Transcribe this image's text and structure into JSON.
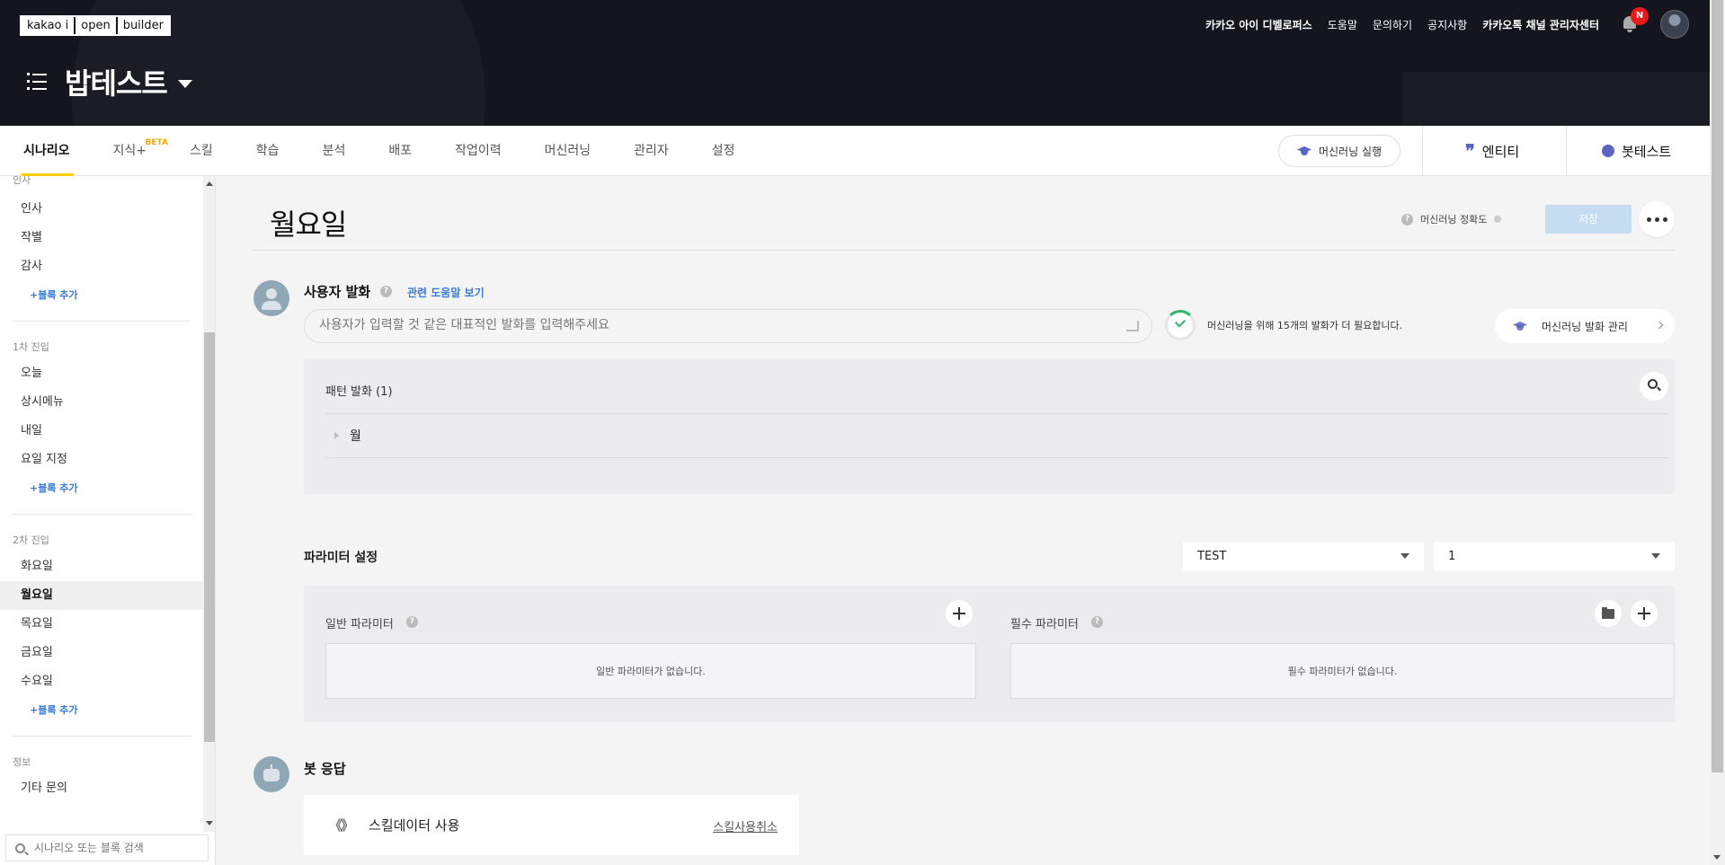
{
  "header": {
    "logo_parts": [
      "kakao i",
      "open",
      "builder"
    ],
    "bot_name": "밥테스트",
    "links": [
      "카카오 아이 디벨로퍼스",
      "도움말",
      "문의하기",
      "공지사항",
      "카카오톡 채널 관리자센터"
    ],
    "notification_badge": "N"
  },
  "nav": {
    "tabs": [
      "시나리오",
      "지식+",
      "스킬",
      "학습",
      "분석",
      "배포",
      "작업이력",
      "머신러닝",
      "관리자",
      "설정"
    ],
    "beta_label": "BETA",
    "ml_run_label": "머신러닝 실행",
    "entity_label": "엔티티",
    "bottest_label": "봇테스트"
  },
  "sidebar": {
    "top_group_label": "인사",
    "top_items": [
      "인사",
      "작별",
      "감사"
    ],
    "add_block_label": "+블록 추가",
    "group1_label": "1차 진입",
    "group1_items": [
      "오늘",
      "상시메뉴",
      "내일",
      "요일 지정"
    ],
    "group2_label": "2차 진입",
    "group2_items": [
      "화요일",
      "월요일",
      "목요일",
      "금요일",
      "수요일"
    ],
    "active_item": "월요일",
    "group3_label": "정보",
    "group3_items": [
      "기타 문의"
    ],
    "search_placeholder": "시나리오 또는 블록 검색"
  },
  "block": {
    "title": "월요일",
    "ml_accuracy_label": "머신러닝 정확도",
    "save_label": "저장"
  },
  "utterance": {
    "section_title": "사용자 발화",
    "help_link": "관련 도움말 보기",
    "input_placeholder": "사용자가 입력할 것 같은 대표적인 발화를 입력해주세요",
    "ml_need_text": "머신러닝을 위해 15개의 발화가 더 필요합니다.",
    "ml_manage_label": "머신러닝 발화 관리",
    "pattern_header": "패턴 발화 (1)",
    "patterns": [
      "월"
    ]
  },
  "params": {
    "section_title": "파라미터 설정",
    "select1_value": "TEST",
    "select2_value": "1",
    "general_label": "일반 파라미터",
    "general_empty": "일반 파라미터가 없습니다.",
    "required_label": "필수 파라미터",
    "required_empty": "필수 파라미터가 없습니다."
  },
  "bot_response": {
    "section_title": "봇 응답",
    "skill_label": "스킬데이터 사용",
    "skill_cancel": "스킬사용취소",
    "code_icon_text": "《》"
  },
  "colors": {
    "header_bg": "#15151f",
    "accent_yellow": "#ffcd00",
    "link_blue": "#3a7bd5",
    "brand_purple": "#5b63c4",
    "save_disabled": "#c6dcf0"
  }
}
